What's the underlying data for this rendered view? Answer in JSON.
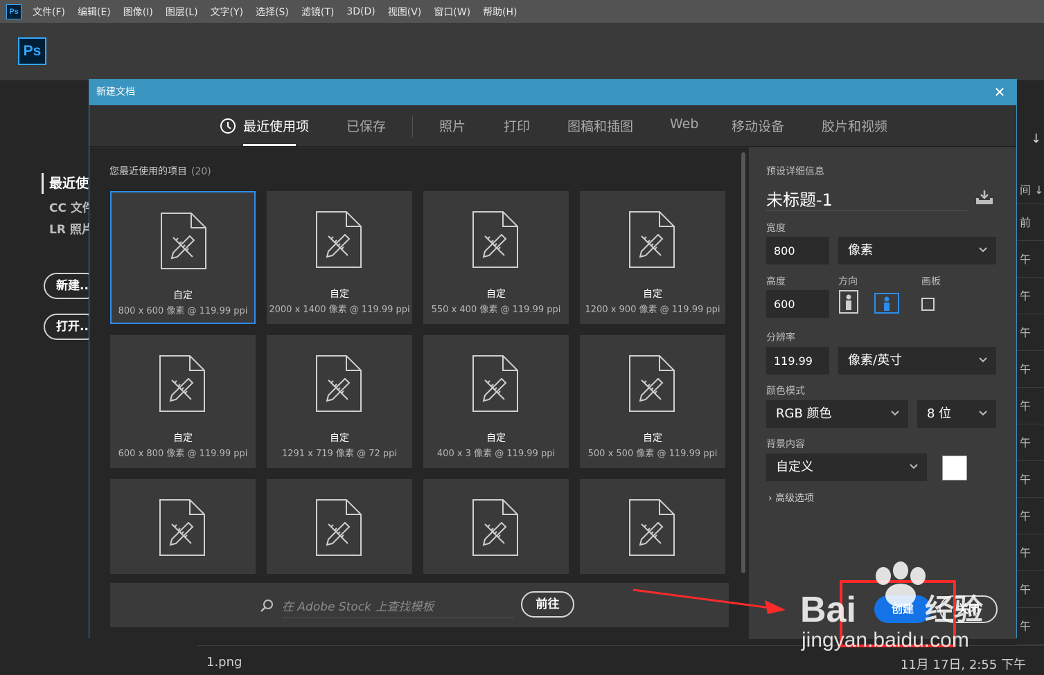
{
  "menubar": {
    "items": [
      "文件(F)",
      "编辑(E)",
      "图像(I)",
      "图层(L)",
      "文字(Y)",
      "选择(S)",
      "滤镜(T)",
      "3D(D)",
      "视图(V)",
      "窗口(W)",
      "帮助(H)"
    ],
    "app_icon": "Ps"
  },
  "app": {
    "logo": "Ps"
  },
  "home": {
    "recent_title": "最近使",
    "sub_items": [
      "CC 文件",
      "LR 照片"
    ],
    "new_button": "新建...",
    "open_button": "打开...",
    "right_header": "间",
    "right_rows": [
      "前",
      "午",
      "午",
      "午",
      "午",
      "午",
      "午",
      "午",
      "午",
      "午",
      "午",
      "午"
    ],
    "file_name": "1.png",
    "file_date": "11月 17日, 2:55 下午"
  },
  "dialog": {
    "title": "新建文档",
    "tabs": [
      {
        "label": "最近使用项",
        "active": true
      },
      {
        "label": "已保存",
        "active": false
      },
      {
        "label": "照片",
        "active": false
      },
      {
        "label": "打印",
        "active": false
      },
      {
        "label": "图稿和插图",
        "active": false
      },
      {
        "label": "Web",
        "active": false
      },
      {
        "label": "移动设备",
        "active": false
      },
      {
        "label": "胶片和视频",
        "active": false
      }
    ],
    "recent_heading": "您最近使用的项目",
    "recent_count": "(20)",
    "cards": [
      {
        "name": "自定",
        "size": "800 x 600 像素 @ 119.99 ppi",
        "selected": true
      },
      {
        "name": "自定",
        "size": "2000 x 1400 像素 @ 119.99 ppi"
      },
      {
        "name": "自定",
        "size": "550 x 400 像素 @ 119.99 ppi"
      },
      {
        "name": "自定",
        "size": "1200 x 900 像素 @ 119.99 ppi"
      },
      {
        "name": "自定",
        "size": "600 x 800 像素 @ 119.99 ppi"
      },
      {
        "name": "自定",
        "size": "1291 x 719 像素 @ 72 ppi"
      },
      {
        "name": "自定",
        "size": "400 x 3 像素 @ 119.99 ppi"
      },
      {
        "name": "自定",
        "size": "500 x 500 像素 @ 119.99 ppi"
      },
      {
        "name": "",
        "size": ""
      },
      {
        "name": "",
        "size": ""
      },
      {
        "name": "",
        "size": ""
      },
      {
        "name": "",
        "size": ""
      }
    ],
    "stock": {
      "placeholder": "在 Adobe Stock 上查找模板",
      "go_button": "前往"
    },
    "preset": {
      "section_label": "预设详细信息",
      "name": "未标题-1",
      "width_label": "宽度",
      "width_value": "800",
      "width_unit": "像素",
      "height_label": "高度",
      "height_value": "600",
      "orientation_label": "方向",
      "artboard_label": "画板",
      "resolution_label": "分辨率",
      "resolution_value": "119.99",
      "resolution_unit": "像素/英寸",
      "color_mode_label": "颜色模式",
      "color_mode": "RGB 颜色",
      "bit_depth": "8 位",
      "background_label": "背景内容",
      "background": "自定义",
      "background_color": "#ffffff",
      "advanced": "高级选项",
      "create_button": "创建",
      "close_button": "关闭"
    }
  },
  "colors": {
    "accent": "#1473e6",
    "title_bar": "#3a94c0",
    "ps_blue": "#31a8ff",
    "annotation": "#ff2a2a"
  },
  "watermark": {
    "brand": "Bai",
    "brand_cn": "经验",
    "url": "jingyan.baidu.com"
  }
}
